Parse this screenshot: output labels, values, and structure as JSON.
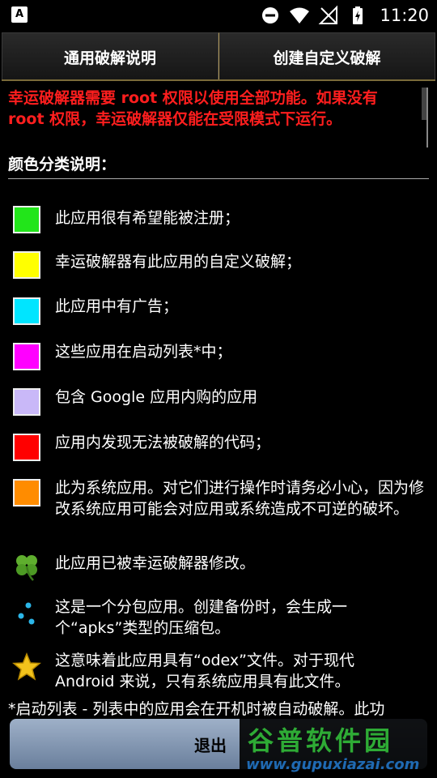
{
  "status_bar": {
    "time": "11:20"
  },
  "tabs": [
    {
      "label": "通用破解说明"
    },
    {
      "label": "创建自定义破解"
    }
  ],
  "warning": {
    "text": "幸运破解器需要 root 权限以使用全部功能。如果没有 root 权限，幸运破解器仅能在受限模式下运行。",
    "color": "#ff1e1e"
  },
  "section_title": "颜色分类说明：",
  "legend": [
    {
      "type": "color",
      "color": "#22e51a",
      "text": "此应用很有希望能被注册；"
    },
    {
      "type": "color",
      "color": "#ffff00",
      "text": "幸运破解器有此应用的自定义破解；"
    },
    {
      "type": "color",
      "color": "#00e5ff",
      "text": "此应用中有广告；"
    },
    {
      "type": "color",
      "color": "#ff00ff",
      "text": "这些应用在启动列表*中；"
    },
    {
      "type": "color",
      "color": "#c9b8f8",
      "text": "包含 Google 应用内购的应用"
    },
    {
      "type": "color",
      "color": "#ff0000",
      "text": "应用内发现无法被破解的代码；"
    },
    {
      "type": "color",
      "color": "#ff8c00",
      "text": "此为系统应用。对它们进行操作时请务必小心，因为修改系统应用可能会对应用或系统造成不可逆的破坏。"
    },
    {
      "type": "icon",
      "icon": "clover-icon",
      "text": "此应用已被幸运破解器修改。"
    },
    {
      "type": "icon",
      "icon": "split-dots-icon",
      "text": "这是一个分包应用。创建备份时，会生成一个“apks”类型的压缩包。"
    },
    {
      "type": "icon",
      "icon": "star-icon",
      "text": "这意味着此应用具有“odex”文件。对于现代 Android 来说，只有系统应用具有此文件。"
    }
  ],
  "footnote": "*启动列表 - 列表中的应用会在开机时被自动破解。此功",
  "exit_button": {
    "label": "退出"
  },
  "watermark": {
    "title": "谷普软件园",
    "url": "www.gupuxiazai.com"
  }
}
